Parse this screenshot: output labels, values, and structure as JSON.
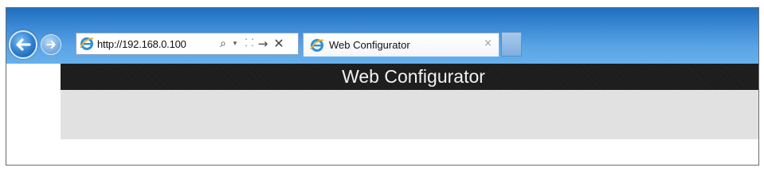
{
  "browser": {
    "address": {
      "url": "http://192.168.0.100"
    },
    "tab": {
      "title": "Web Configurator",
      "close_glyph": "×"
    },
    "toolbar": {
      "back_glyph": "←",
      "forward_glyph": "→",
      "search_glyph": "⌕",
      "dropdown_glyph": "▾",
      "compat_glyph": "⸬",
      "refresh_glyph": "→",
      "stop_glyph": "✕"
    },
    "icons": [
      "back-icon",
      "forward-icon",
      "ie-page-icon",
      "search-icon",
      "dropdown-arrow-icon",
      "compatibility-view-icon",
      "refresh-icon",
      "stop-icon",
      "close-icon"
    ],
    "colors": {
      "chrome_blue": "#3d8ad6",
      "header_black": "#1b1b1b",
      "panel_grey": "#e1e1e1"
    }
  },
  "page": {
    "header_title": "Web Configurator"
  }
}
